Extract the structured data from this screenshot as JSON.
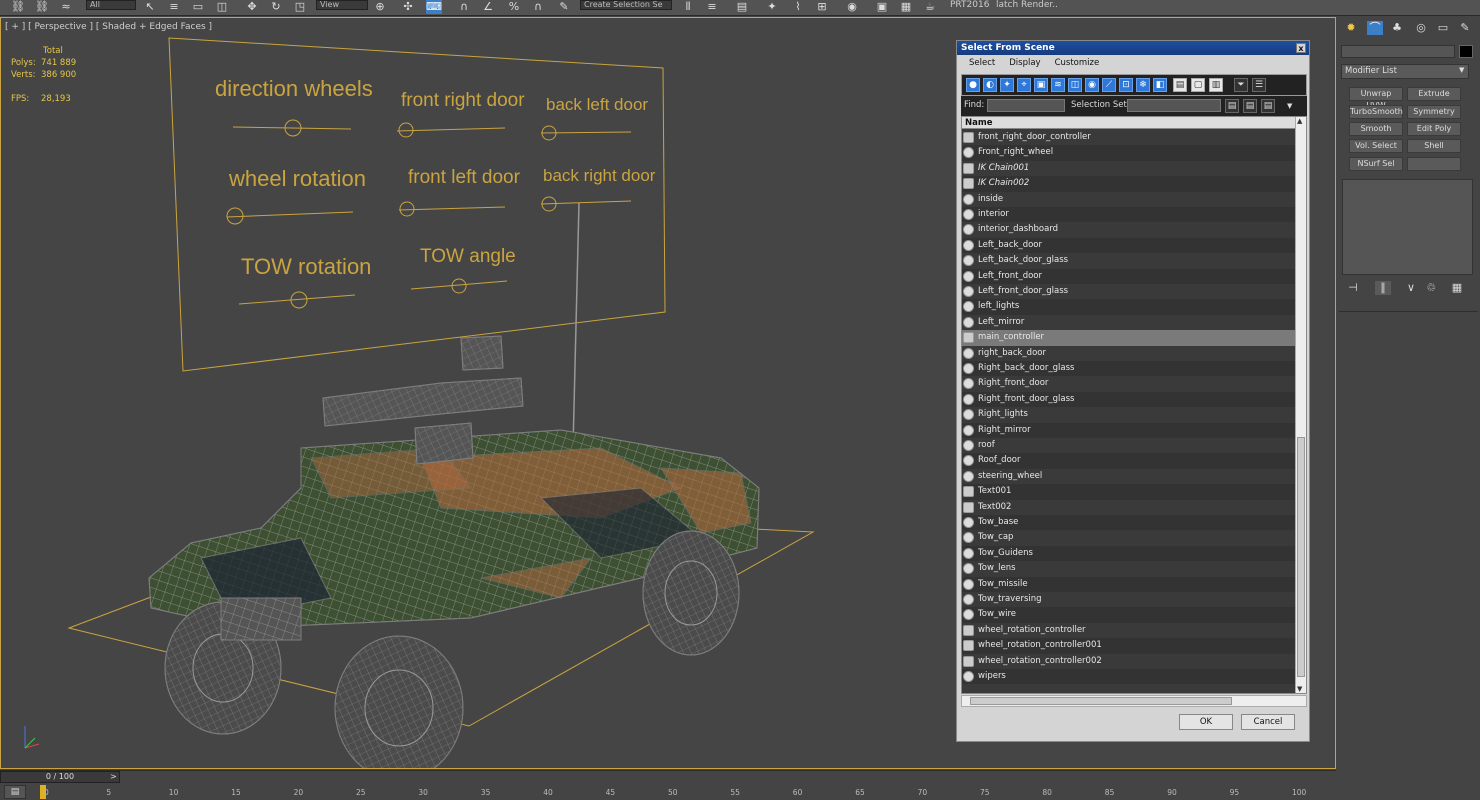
{
  "toolbar": {
    "filter_value": "All",
    "view_value": "View",
    "selection_set": "Create Selection Se",
    "renderer": "PRT2016",
    "batch_render": "latch Render.."
  },
  "viewport": {
    "label": "[ + ] [ Perspective ] [ Shaded + Edged Faces ]",
    "stats": {
      "header": "Total",
      "polys_label": "Polys:",
      "polys_value": "741 889",
      "verts_label": "Verts:",
      "verts_value": "386 900",
      "fps_label": "FPS:",
      "fps_value": "28,193"
    },
    "controls": [
      "direction wheels",
      "front right door",
      "back left door",
      "wheel rotation",
      "front left door",
      "back right door",
      "TOW rotation",
      "TOW angle"
    ],
    "accent_color": "#c9a440"
  },
  "dialog": {
    "title": "Select From Scene",
    "close": "x",
    "menu": [
      "Select",
      "Display",
      "Customize"
    ],
    "find_label": "Find:",
    "selection_set_label": "Selection Set:",
    "column_name": "Name",
    "items": [
      {
        "name": "front_right_door_controller",
        "icon": "helper"
      },
      {
        "name": "Front_right_wheel",
        "icon": "geometry"
      },
      {
        "name": "IK Chain001",
        "icon": "helper",
        "italic": true
      },
      {
        "name": "IK Chain002",
        "icon": "helper",
        "italic": true
      },
      {
        "name": "inside",
        "icon": "geometry"
      },
      {
        "name": "interior",
        "icon": "geometry"
      },
      {
        "name": "interior_dashboard",
        "icon": "geometry"
      },
      {
        "name": "Left_back_door",
        "icon": "geometry"
      },
      {
        "name": "Left_back_door_glass",
        "icon": "geometry"
      },
      {
        "name": "Left_front_door",
        "icon": "geometry"
      },
      {
        "name": "Left_front_door_glass",
        "icon": "geometry"
      },
      {
        "name": "left_lights",
        "icon": "geometry"
      },
      {
        "name": "Left_mirror",
        "icon": "geometry"
      },
      {
        "name": "main_controller",
        "icon": "helper",
        "selected": true
      },
      {
        "name": "right_back_door",
        "icon": "geometry"
      },
      {
        "name": "Right_back_door_glass",
        "icon": "geometry"
      },
      {
        "name": "Right_front_door",
        "icon": "geometry"
      },
      {
        "name": "Right_front_door_glass",
        "icon": "geometry"
      },
      {
        "name": "Right_lights",
        "icon": "geometry"
      },
      {
        "name": "Right_mirror",
        "icon": "geometry"
      },
      {
        "name": "roof",
        "icon": "geometry"
      },
      {
        "name": "Roof_door",
        "icon": "geometry"
      },
      {
        "name": "steering_wheel",
        "icon": "geometry"
      },
      {
        "name": "Text001",
        "icon": "helper"
      },
      {
        "name": "Text002",
        "icon": "helper"
      },
      {
        "name": "Tow_base",
        "icon": "geometry"
      },
      {
        "name": "Tow_cap",
        "icon": "geometry"
      },
      {
        "name": "Tow_Guidens",
        "icon": "geometry"
      },
      {
        "name": "Tow_lens",
        "icon": "geometry"
      },
      {
        "name": "Tow_missile",
        "icon": "geometry"
      },
      {
        "name": "Tow_traversing",
        "icon": "geometry"
      },
      {
        "name": "Tow_wire",
        "icon": "geometry"
      },
      {
        "name": "wheel_rotation_controller",
        "icon": "helper"
      },
      {
        "name": "wheel_rotation_controller001",
        "icon": "helper"
      },
      {
        "name": "wheel_rotation_controller002",
        "icon": "helper"
      },
      {
        "name": "wipers",
        "icon": "geometry"
      }
    ],
    "ok_label": "OK",
    "cancel_label": "Cancel"
  },
  "command_panel": {
    "modifier_list_label": "Modifier List",
    "buttons": [
      "Unwrap UVW",
      "Extrude",
      "TurboSmooth",
      "Symmetry",
      "Smooth",
      "Edit Poly",
      "Vol. Select",
      "Shell"
    ],
    "buttons_col2_row4": "Edit Poly",
    "nsurf": "NSurf Sel"
  },
  "timeline": {
    "frame_counter": "0 / 100",
    "ticks": [
      "0",
      "5",
      "10",
      "15",
      "20",
      "25",
      "30",
      "35",
      "40",
      "45",
      "50",
      "55",
      "60",
      "65",
      "70",
      "75",
      "80",
      "85",
      "90",
      "95",
      "100"
    ]
  }
}
